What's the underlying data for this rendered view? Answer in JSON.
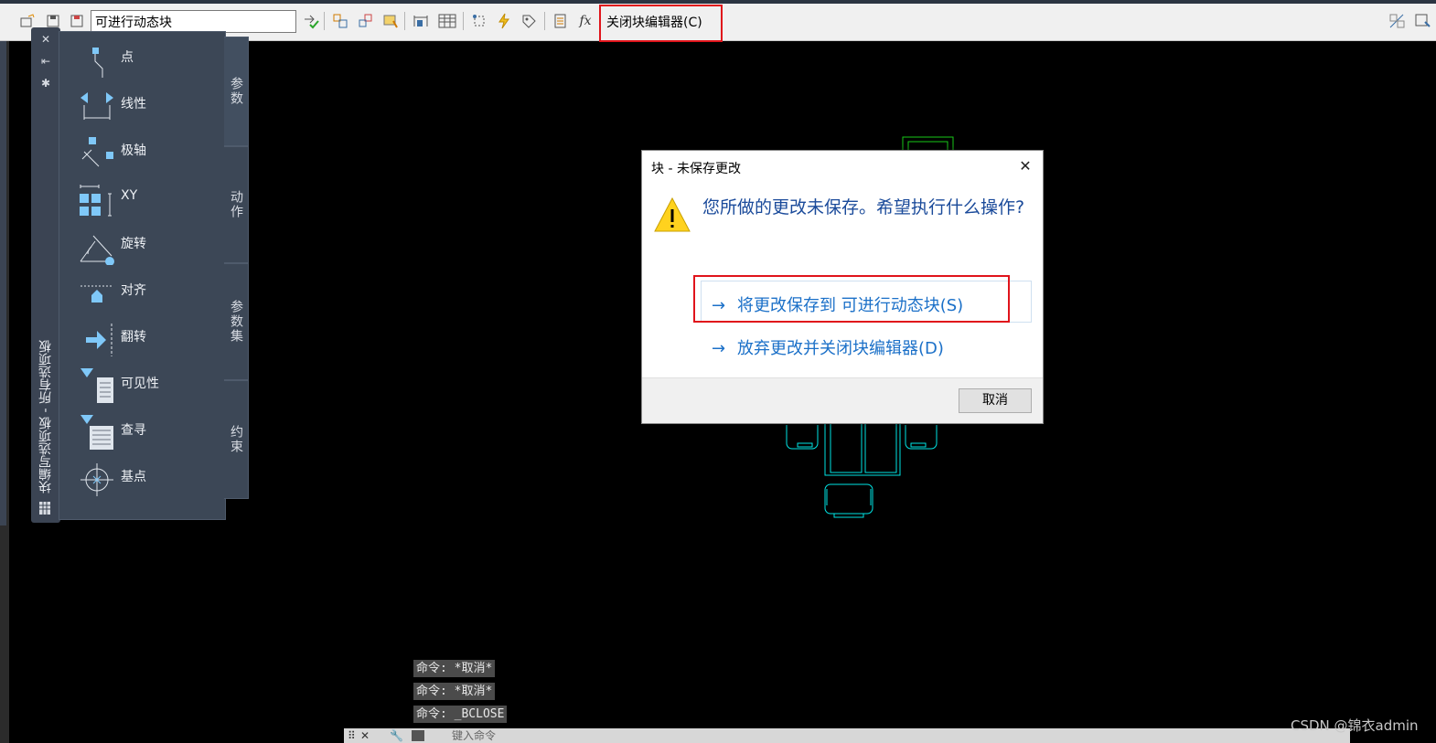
{
  "toolbar": {
    "block_name": "可进行动态块",
    "close_editor_label": "关闭块编辑器(C)",
    "fx_label": "fx"
  },
  "palette": {
    "title": "块编写选项板 - 所有选项板",
    "items": [
      {
        "label": "点"
      },
      {
        "label": "线性"
      },
      {
        "label": "极轴"
      },
      {
        "label": "XY"
      },
      {
        "label": "旋转"
      },
      {
        "label": "对齐"
      },
      {
        "label": "翻转"
      },
      {
        "label": "可见性"
      },
      {
        "label": "查寻"
      },
      {
        "label": "基点"
      }
    ],
    "tabs": [
      {
        "label": "参数"
      },
      {
        "label": "动作"
      },
      {
        "label": "参数集"
      },
      {
        "label": "约束"
      }
    ]
  },
  "dialog": {
    "title": "块 - 未保存更改",
    "message": "您所做的更改未保存。希望执行什么操作?",
    "option_save": "将更改保存到 可进行动态块(S)",
    "option_discard": "放弃更改并关闭块编辑器(D)",
    "arrow": "→",
    "cancel_label": "取消"
  },
  "command_history": [
    "命令: *取消*",
    "命令: *取消*",
    "命令: _BCLOSE"
  ],
  "command_prompt": "键入命令",
  "watermark": "CSDN @锦衣admin",
  "colors": {
    "highlight_red": "#e0141b",
    "drawing_cyan": "#00e5e5",
    "drawing_green": "#19c819",
    "dialog_blue": "#1b70c8"
  }
}
